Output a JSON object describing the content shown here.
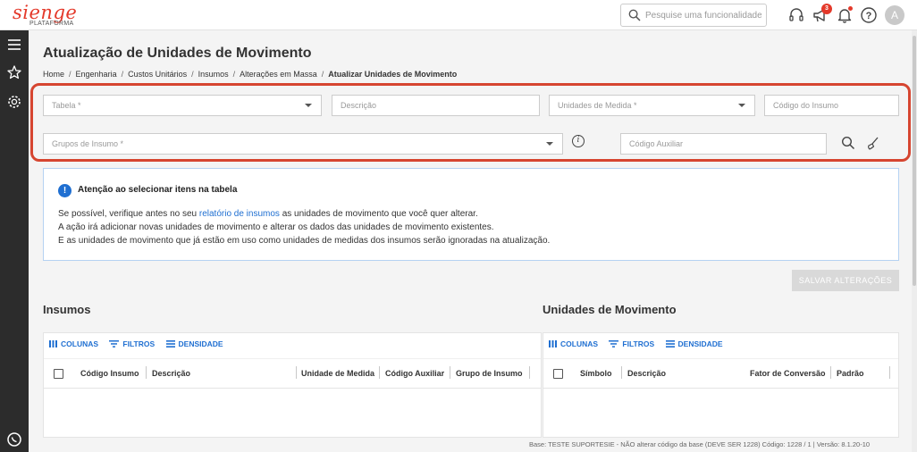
{
  "header": {
    "logo_text": "sienge",
    "logo_sub": "PLATAFORMA",
    "search_placeholder": "Pesquise uma funcionalidade.",
    "notification_count": "3",
    "avatar_letter": "A",
    "accent_color": "#e4392a"
  },
  "page": {
    "title": "Atualização de Unidades de Movimento",
    "breadcrumb": [
      "Home",
      "Engenharia",
      "Custos Unitários",
      "Insumos",
      "Alterações em Massa",
      "Atualizar Unidades de Movimento"
    ],
    "breadcrumb_sep": "/"
  },
  "filters": {
    "tabela": "Tabela *",
    "descricao": "Descrição",
    "unidades_medida": "Unidades de Medida *",
    "codigo_insumo": "Código do Insumo",
    "grupos_insumo": "Grupos de Insumo *",
    "codigo_auxiliar": "Código Auxiliar",
    "info_icon_text": "i"
  },
  "alert": {
    "title": "Atenção ao selecionar itens na tabela",
    "line1_before": "Se possível, verifique antes no seu ",
    "line1_link": "relatório de insumos",
    "line1_after": " as unidades de movimento que você quer alterar.",
    "line2": "A ação irá adicionar novas unidades de movimento e alterar os dados das unidades de movimento existentes.",
    "line3": "E as unidades de movimento que já estão em uso como unidades de medidas dos insumos serão ignoradas na atualização.",
    "link_color": "#1f6fd1"
  },
  "actions": {
    "save_label": "SALVAR ALTERAÇÕES"
  },
  "grids": {
    "toolbar": {
      "columns": "COLUNAS",
      "filters": "FILTROS",
      "density": "DENSIDADE"
    },
    "insumos": {
      "title": "Insumos",
      "columns": [
        "Código Insumo",
        "Descrição",
        "Unidade de Medida",
        "Código Auxiliar",
        "Grupo de Insumo"
      ]
    },
    "unidades": {
      "title": "Unidades de Movimento",
      "columns": [
        "Símbolo",
        "Descrição",
        "Fator de Conversão",
        "Padrão"
      ]
    }
  },
  "footer": {
    "text": "Base: TESTE SUPORTESIE - NÃO alterar código da base (DEVE SER 1228)  Código: 1228 / 1 | Versão: 8.1.20-10"
  }
}
